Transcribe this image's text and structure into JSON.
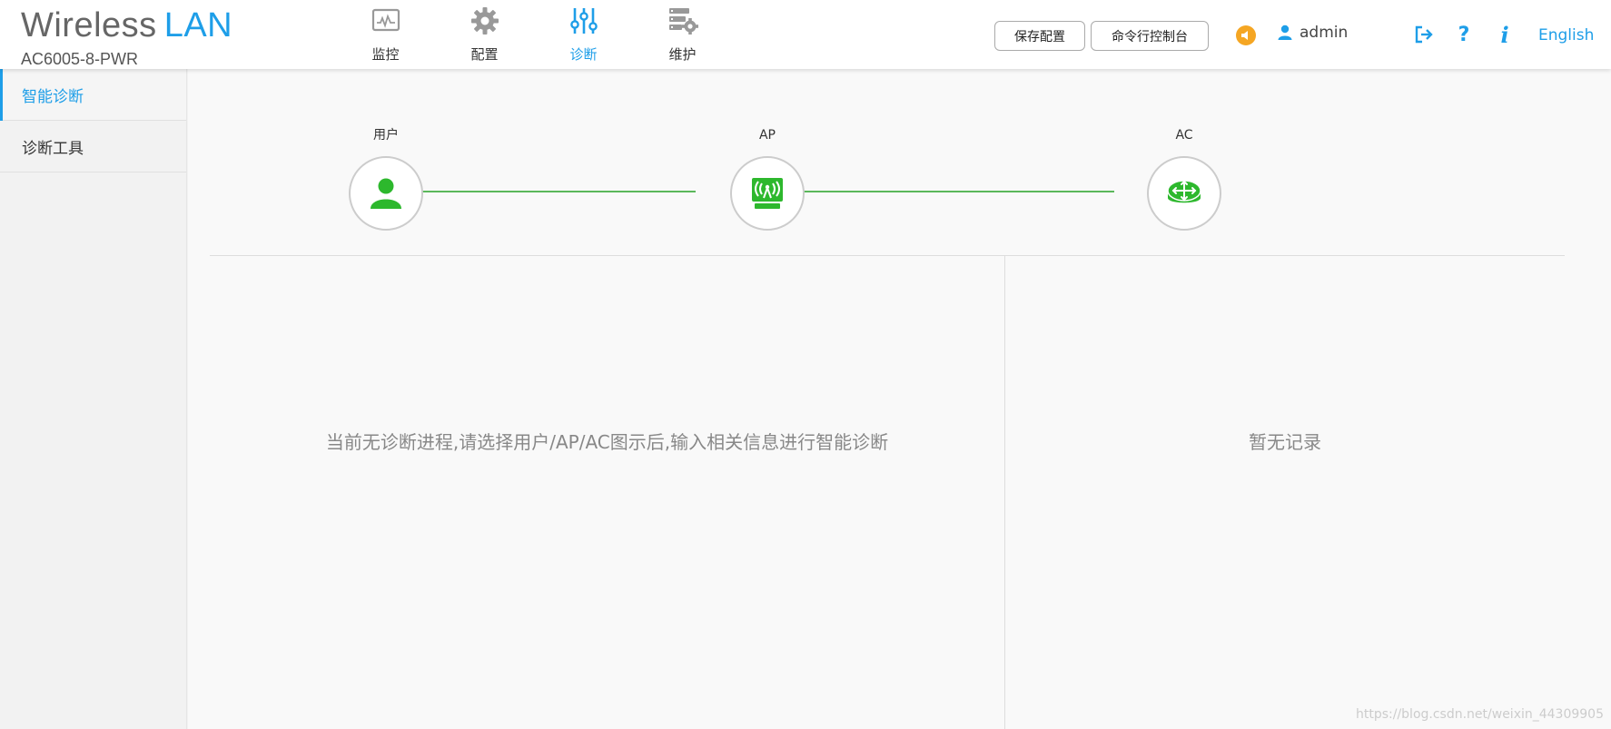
{
  "brand": {
    "title": "Wireless",
    "title_accent": "LAN",
    "model": "AC6005-8-PWR"
  },
  "nav": [
    {
      "label": "监控",
      "icon": "monitor-icon"
    },
    {
      "label": "配置",
      "icon": "gear-icon"
    },
    {
      "label": "诊断",
      "icon": "sliders-icon",
      "active": true
    },
    {
      "label": "维护",
      "icon": "server-gear-icon"
    }
  ],
  "toolbar": {
    "save_label": "保存配置",
    "cli_label": "命令行控制台"
  },
  "user": {
    "name": "admin"
  },
  "help_label": "?",
  "info_label": "i",
  "language": "English",
  "sidebar": {
    "items": [
      {
        "label": "智能诊断",
        "active": true
      },
      {
        "label": "诊断工具"
      }
    ]
  },
  "topology": {
    "nodes": [
      {
        "label": "用户",
        "icon": "user-icon"
      },
      {
        "label": "AP",
        "icon": "access-point-icon"
      },
      {
        "label": "AC",
        "icon": "router-icon"
      }
    ]
  },
  "main": {
    "left_message": "当前无诊断进程,请选择用户/AP/AC图示后,输入相关信息进行智能诊断",
    "right_message": "暂无记录"
  },
  "watermark": "https://blog.csdn.net/weixin_44309905",
  "colors": {
    "accent": "#1e9ee8",
    "green": "#2db82d",
    "orange": "#f5a623",
    "link_line": "#5bb85b"
  }
}
